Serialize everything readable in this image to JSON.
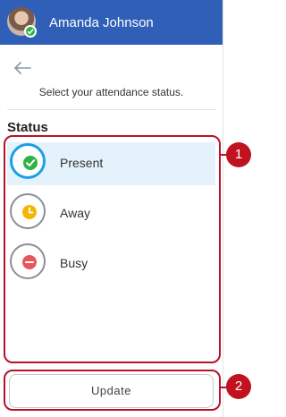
{
  "header": {
    "user_name": "Amanda Johnson",
    "avatar_status_color": "#2db245",
    "bg_color": "#2f5fb6"
  },
  "navigation": {
    "back_icon": "arrow-left-icon"
  },
  "subtitle": "Select your attendance status.",
  "status": {
    "title": "Status",
    "selected": "Present",
    "options": [
      {
        "label": "Present",
        "icon": "check-circle-icon",
        "color": "#2db245"
      },
      {
        "label": "Away",
        "icon": "clock-icon",
        "color": "#f2b705"
      },
      {
        "label": "Busy",
        "icon": "minus-circle-icon",
        "color": "#e8565c"
      }
    ]
  },
  "update_button": {
    "label": "Update"
  },
  "annotations": {
    "markers": [
      "1",
      "2"
    ],
    "color": "#c1121f"
  }
}
